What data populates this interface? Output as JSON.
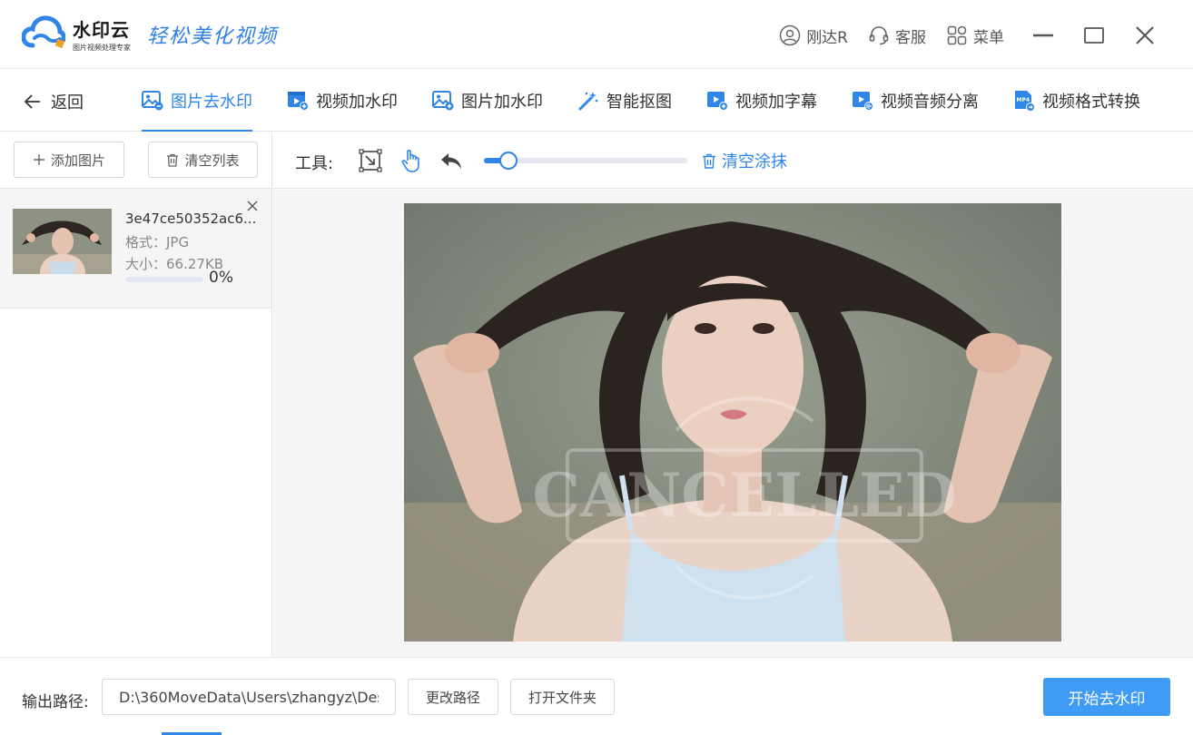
{
  "brand": {
    "name": "水印云",
    "sub": "图片视频处理专家",
    "slogan": "轻松美化视频"
  },
  "header": {
    "user": "刚达R",
    "service": "客服",
    "menu": "菜单"
  },
  "nav": {
    "back": "返回",
    "tabs": [
      {
        "label": "图片去水印",
        "icon": "image-remove-icon",
        "active": true
      },
      {
        "label": "视频加水印",
        "icon": "video-add-icon",
        "active": false
      },
      {
        "label": "图片加水印",
        "icon": "image-add-icon",
        "active": false
      },
      {
        "label": "智能抠图",
        "icon": "magic-wand-icon",
        "active": false
      },
      {
        "label": "视频加字幕",
        "icon": "video-subtitle-icon",
        "active": false
      },
      {
        "label": "视频音频分离",
        "icon": "video-audio-split-icon",
        "active": false
      },
      {
        "label": "视频格式转换",
        "icon": "mp4-convert-icon",
        "active": false
      }
    ]
  },
  "left": {
    "add_label": "添加图片",
    "clear_label": "清空列表",
    "files": [
      {
        "name": "3e47ce50352ac6...",
        "format": "格式：JPG",
        "size": "大小：66.27KB",
        "progress": 0,
        "progress_text": "0%"
      }
    ]
  },
  "editor": {
    "tools_label": "工具:",
    "brush_size": 0.12,
    "clear_mask_label": "清空涂抹"
  },
  "photo": {
    "watermark": "CANCELLED"
  },
  "bottom": {
    "output_label": "输出路径:",
    "path_value": "D:\\360MoveData\\Users\\zhangyz\\Des",
    "change_path": "更改路径",
    "open_folder": "打开文件夹",
    "start": "开始去水印"
  },
  "colors": {
    "accent": "#2f86e8",
    "primary_button": "#3f9bf5"
  }
}
